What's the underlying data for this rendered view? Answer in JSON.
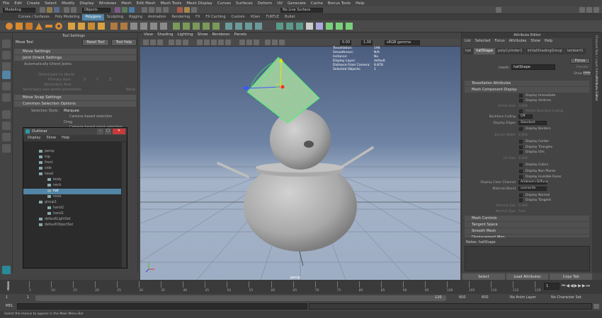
{
  "menubar": [
    "File",
    "Edit",
    "Create",
    "Select",
    "Modify",
    "Display",
    "Windows",
    "Mesh",
    "Edit Mesh",
    "Mesh Tools",
    "Mesh Display",
    "Curves",
    "Surfaces",
    "Deform",
    "UV",
    "Generate",
    "Cache",
    "Bonus Tools",
    "Help"
  ],
  "statusline": {
    "workspace": "Modeling",
    "objects": "Objects",
    "no_live": "No Live Surface"
  },
  "shelf_tabs": [
    "Curves / Surfaces",
    "Poly Modeling",
    "Polygons",
    "Sculpting",
    "Rigging",
    "Animation",
    "Rendering",
    "FX",
    "FX Caching",
    "Custom",
    "XGen",
    "TURTLE",
    "Bullet"
  ],
  "shelf_active": "Polygons",
  "tool_settings": {
    "panel_title": "Tool Settings",
    "tool_name": "Move Tool",
    "reset_label": "Reset Tool",
    "help_label": "Tool Help",
    "sections": [
      "Move Settings",
      "Joint Orient Settings",
      "Move Snap Settings",
      "Common Selection Options"
    ],
    "auto_orient": "Automatically Orient Joints",
    "orient_world": "Orient Joint to World",
    "primary_axis": "Primary Axis:",
    "secondary_axis": "Secondary Axis:",
    "sec_world_orient": "Secondary axis world orientation:",
    "axis_vals": [
      "X",
      "Y",
      "Z",
      "None"
    ],
    "selection_style": "Selection Style:",
    "marquee": "Marquee",
    "camera_based": "Camera based selection",
    "drag": "Drag",
    "camera_paint": "Camera based paint selection"
  },
  "viewport": {
    "menu": [
      "View",
      "Shading",
      "Lighting",
      "Show",
      "Renderer",
      "Panels"
    ],
    "colorspace": "sRGB gamma",
    "val1": "0.00",
    "val2": "1.00",
    "camera_label": "persp",
    "hud": [
      {
        "k": "Tessellation:",
        "v": "196"
      },
      {
        "k": "Smoothness:",
        "v": "N/A"
      },
      {
        "k": "Instance:",
        "v": "No"
      },
      {
        "k": "Display Layer:",
        "v": "default"
      },
      {
        "k": "Distance From Camera:",
        "v": "8.878"
      },
      {
        "k": "Selected Objects:",
        "v": "1"
      }
    ]
  },
  "attribute_editor": {
    "title": "Attribute Editor",
    "menu": [
      "List",
      "Selected",
      "Focus",
      "Attributes",
      "Show",
      "Help"
    ],
    "tabs": [
      "hat",
      "hatShape",
      "polyCylinder1",
      "initialShadingGroup",
      "lambert1"
    ],
    "active_tab": "hatShape",
    "mesh_label": "mesh:",
    "mesh_value": "hatShape",
    "focus": "Focus",
    "presets": "Presets",
    "show": "Show",
    "hide": "Hide",
    "sections_top": [
      "Tessellation Attributes",
      "Mesh Component Display"
    ],
    "display_immediate": "Display Immediate",
    "display_vertices": "Display Vertices",
    "vertex_size": "Vertex Size",
    "vertex_size_val": "3.000",
    "vertex_backface": "Vertex Backface Culling",
    "backface_culling": "Backface Culling",
    "backface_val": "Off",
    "display_edges": "Display Edges",
    "display_edges_val": "Standard",
    "display_borders": "Display Borders",
    "border_width": "Border Width",
    "border_width_val": "2.000",
    "display_center": "Display Center",
    "display_triangles": "Display Triangles",
    "display_uvs": "Display UVs",
    "uv_size": "UV Size",
    "uv_size_val": "4.000",
    "display_colors": "Display Colors",
    "display_nonplanar": "Display Non Planar",
    "display_invisible": "Display Invisible Faces",
    "display_color_channel": "Display Color Channel",
    "display_color_channel_val": "Ambient+Diffuse",
    "material_blend": "Material Blend",
    "material_blend_val": "overwrite",
    "display_normal": "Display Normal",
    "display_tangent": "Display Tangent",
    "normal_size": "Normal Size",
    "normal_size_val": "0.400",
    "normal_type": "Normal Type",
    "normal_type_val": "Face",
    "sections_bottom": [
      "Mesh Controls",
      "Tangent Space",
      "Smooth Mesh",
      "Displacement Map"
    ],
    "notes": "Notes: hatShape",
    "bottom_buttons": [
      "Select",
      "Load Attributes",
      "Copy Tab"
    ],
    "side_tabs": [
      "Channel Box / Layer Editor",
      "Attribute Editor"
    ]
  },
  "outliner": {
    "title": "Outliner",
    "menu": [
      "Display",
      "Show",
      "Help"
    ],
    "items": [
      {
        "label": "persp",
        "indent": 1
      },
      {
        "label": "top",
        "indent": 1
      },
      {
        "label": "front",
        "indent": 1
      },
      {
        "label": "side",
        "indent": 1
      },
      {
        "label": "head",
        "indent": 1
      },
      {
        "label": "body",
        "indent": 2
      },
      {
        "label": "neck",
        "indent": 2
      },
      {
        "label": "hat",
        "indent": 2,
        "selected": true
      },
      {
        "label": "nose",
        "indent": 2
      },
      {
        "label": "group1",
        "indent": 1
      },
      {
        "label": "hand2",
        "indent": 2
      },
      {
        "label": "hand1",
        "indent": 2
      },
      {
        "label": "defaultLightSet",
        "indent": 1
      },
      {
        "label": "defaultObjectSet",
        "indent": 1
      }
    ]
  },
  "timeline": {
    "ticks": [
      "1",
      "5",
      "10",
      "15",
      "20",
      "25",
      "30",
      "35",
      "40",
      "45",
      "50",
      "55",
      "60",
      "65",
      "70",
      "75",
      "80",
      "85",
      "90",
      "95",
      "100",
      "105",
      "110",
      "115",
      "120"
    ],
    "current_frame": "1",
    "range_start": "1",
    "range_start2": "1",
    "range_end": "120",
    "range_max": "600",
    "anim_end": "600",
    "anim_layer": "No Anim Layer",
    "char_set": "No Character Set"
  },
  "cmdline": {
    "lang": "MEL"
  },
  "helpline": "Select the menus to appear in the Main Menu Bar",
  "colors": {
    "accent": "#5285a6",
    "viewport_top": "#46587a",
    "viewport_bottom": "#a4b3c8"
  }
}
